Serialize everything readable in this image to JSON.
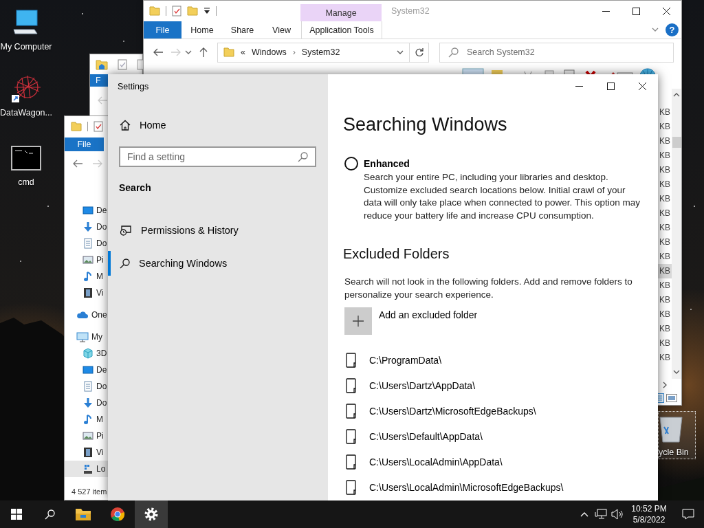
{
  "desktop_icons": [
    {
      "label": "My Computer",
      "kind": "computer",
      "selected": false
    },
    {
      "label": "DataWagon...",
      "kind": "starburst",
      "selected": false
    },
    {
      "label": "cmd",
      "kind": "console",
      "selected": false
    },
    {
      "label": "ycle Bin",
      "kind": "bin",
      "selected": true
    }
  ],
  "explorer_main": {
    "title": "System32",
    "context_tab": "Manage",
    "ribbon_tabs": [
      {
        "label": "File",
        "kind": "file"
      },
      {
        "label": "Home",
        "kind": "tab"
      },
      {
        "label": "Share",
        "kind": "tab"
      },
      {
        "label": "View",
        "kind": "tab"
      },
      {
        "label": "Application Tools",
        "kind": "context"
      }
    ],
    "help": "?",
    "address": {
      "prefix": "«",
      "segments": [
        "Windows",
        "System32"
      ],
      "separator": "›"
    },
    "search": {
      "placeholder": "Search System32"
    },
    "sizes": [
      {
        "text": "KB",
        "selected": false
      },
      {
        "text": "KB",
        "selected": false
      },
      {
        "text": "KB",
        "selected": false
      },
      {
        "text": "KB",
        "selected": false
      },
      {
        "text": "KB",
        "selected": false
      },
      {
        "text": "KB",
        "selected": false
      },
      {
        "text": "KB",
        "selected": false
      },
      {
        "text": "KB",
        "selected": false
      },
      {
        "text": "KB",
        "selected": false
      },
      {
        "text": "KB",
        "selected": false
      },
      {
        "text": "KB",
        "selected": false
      },
      {
        "text": "KB",
        "selected": true
      },
      {
        "text": "KB",
        "selected": false
      },
      {
        "text": "KB",
        "selected": false
      },
      {
        "text": "KB",
        "selected": false
      },
      {
        "text": "KB",
        "selected": false
      },
      {
        "text": "KB",
        "selected": false
      },
      {
        "text": "KB",
        "selected": false
      }
    ]
  },
  "explorer_middle": {
    "file_tab": "F"
  },
  "explorer_back": {
    "file_tab": "File",
    "nav_quick_items": [
      {
        "label": "De",
        "kind": "desktop",
        "selected": false
      },
      {
        "label": "Do",
        "kind": "download",
        "selected": false
      },
      {
        "label": "Do",
        "kind": "document",
        "selected": false
      },
      {
        "label": "Pi",
        "kind": "pictures",
        "selected": false
      },
      {
        "label": "M",
        "kind": "music",
        "selected": false
      },
      {
        "label": "Vi",
        "kind": "videos",
        "selected": false
      }
    ],
    "nav_tree": [
      {
        "label": "One",
        "kind": "cloud",
        "selected": false
      },
      {
        "label": "My",
        "kind": "pc",
        "selected": false,
        "children": [
          {
            "label": "3D",
            "kind": "cube",
            "selected": false
          },
          {
            "label": "De",
            "kind": "desktop",
            "selected": false
          },
          {
            "label": "Do",
            "kind": "document",
            "selected": false
          },
          {
            "label": "Do",
            "kind": "download",
            "selected": false
          },
          {
            "label": "M",
            "kind": "music",
            "selected": false
          },
          {
            "label": "Pi",
            "kind": "pictures",
            "selected": false
          },
          {
            "label": "Vi",
            "kind": "videos",
            "selected": false
          },
          {
            "label": "Lo",
            "kind": "drive",
            "selected": true
          }
        ]
      }
    ],
    "status": "4 527 item"
  },
  "settings": {
    "title": "Settings",
    "home": "Home",
    "search": {
      "placeholder": "Find a setting"
    },
    "section": "Search",
    "nav": [
      {
        "label": "Permissions & History",
        "kind": "history",
        "selected": false
      },
      {
        "label": "Searching Windows",
        "kind": "search",
        "selected": true
      }
    ],
    "heading": "Searching Windows",
    "option": {
      "label": "Enhanced",
      "selected": false,
      "description": "Search your entire PC, including your libraries and desktop. Customize excluded search locations below. Initial crawl of your data will only take place when connected to power. This option may reduce your battery life and increase CPU consumption."
    },
    "excluded_heading": "Excluded Folders",
    "excluded_text": "Search will not look in the following folders. Add and remove folders to personalize your search experience.",
    "add_label": "Add an excluded folder",
    "folders": [
      "C:\\ProgramData\\",
      "C:\\Users\\Dartz\\AppData\\",
      "C:\\Users\\Dartz\\MicrosoftEdgeBackups\\",
      "C:\\Users\\Default\\AppData\\",
      "C:\\Users\\LocalAdmin\\AppData\\",
      "C:\\Users\\LocalAdmin\\MicrosoftEdgeBackups\\"
    ]
  },
  "taskbar": {
    "apps": [
      {
        "kind": "explorer",
        "selected": false
      },
      {
        "kind": "browser",
        "selected": false
      },
      {
        "kind": "settings",
        "selected": true
      }
    ],
    "time": "10:52 PM",
    "date": "5/8/2022"
  }
}
